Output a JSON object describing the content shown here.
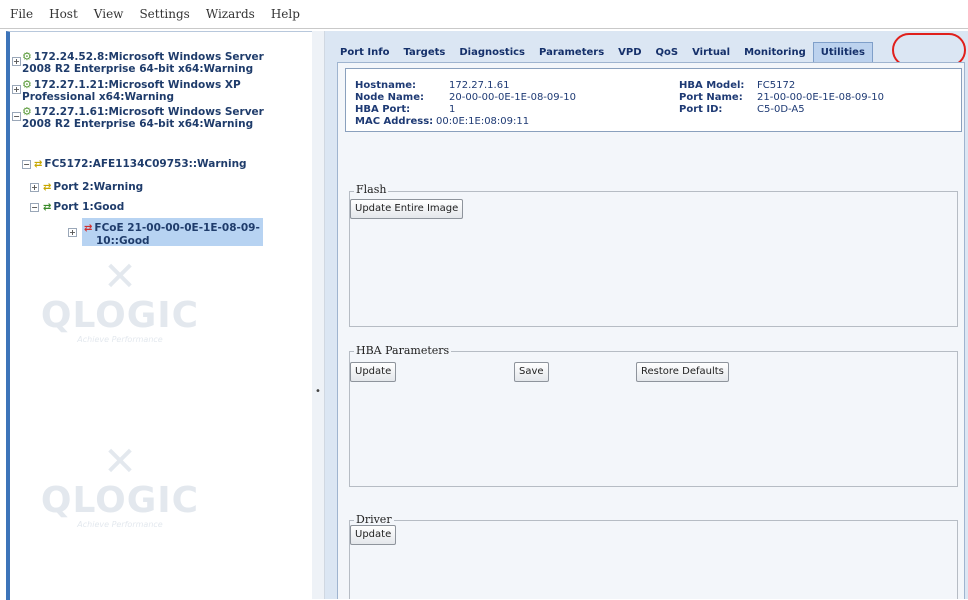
{
  "menu": {
    "items": [
      "File",
      "Host",
      "View",
      "Settings",
      "Wizards",
      "Help"
    ]
  },
  "tree": {
    "nodes": [
      {
        "label": "172.24.52.8:Microsoft Windows Server",
        "label2": "2008 R2 Enterprise 64-bit x64:Warning",
        "icon": "host-icon"
      },
      {
        "label": "172.27.1.21:Microsoft Windows XP",
        "label2": "Professional x64:Warning",
        "icon": "host-icon"
      },
      {
        "label": "172.27.1.61:Microsoft Windows Server",
        "label2": "2008 R2 Enterprise 64-bit x64:Warning",
        "icon": "host-icon"
      },
      {
        "label": "FC5172:AFE1134C09753::Warning",
        "icon": "adapter-icon"
      },
      {
        "label": "Port 2:Warning",
        "icon": "port-warning-icon"
      },
      {
        "label": "Port 1:Good",
        "icon": "port-good-icon"
      },
      {
        "label": "FCoE 21-00-00-0E-1E-08-09-",
        "label2": "10::Good",
        "icon": "fcoe-icon"
      }
    ],
    "watermark": {
      "brand": "QLOGIC",
      "tagline": "Achieve Performance"
    }
  },
  "tabs": [
    {
      "label": "Port Info",
      "selected": false
    },
    {
      "label": "Targets",
      "selected": false
    },
    {
      "label": "Diagnostics",
      "selected": false
    },
    {
      "label": "Parameters",
      "selected": false
    },
    {
      "label": "VPD",
      "selected": false
    },
    {
      "label": "QoS",
      "selected": false
    },
    {
      "label": "Virtual",
      "selected": false
    },
    {
      "label": "Monitoring",
      "selected": false
    },
    {
      "label": "Utilities",
      "selected": true
    }
  ],
  "info": {
    "hostname_label": "Hostname:",
    "hostname_value": "172.27.1.61",
    "node_name_label": "Node Name:",
    "node_name_value": "20-00-00-0E-1E-08-09-10",
    "hba_port_label": "HBA Port:",
    "hba_port_value": "1",
    "mac_label": "MAC Address:",
    "mac_value": "00:0E:1E:08:09:11",
    "hba_model_label": "HBA Model:",
    "hba_model_value": "FC5172",
    "port_name_label": "Port Name:",
    "port_name_value": "21-00-00-0E-1E-08-09-10",
    "port_id_label": "Port ID:",
    "port_id_value": "C5-0D-A5"
  },
  "flash": {
    "title": "Flash",
    "update_entire_image": "Update Entire Image"
  },
  "hba_parameters": {
    "title": "HBA Parameters",
    "update": "Update",
    "save": "Save",
    "restore_defaults": "Restore Defaults"
  },
  "driver": {
    "title": "Driver",
    "update": "Update"
  },
  "splitter": {
    "dot": "•"
  },
  "colors": {
    "accent": "#3d74b9",
    "panel_bg": "#dbe6f3",
    "highlight": "#e0201c",
    "selected_tab": "#bcd2ee"
  }
}
